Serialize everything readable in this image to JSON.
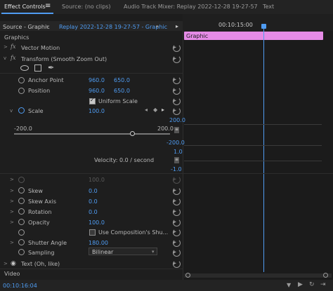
{
  "tabs": {
    "effect_controls": "Effect Controls",
    "menu_icon": "≡",
    "source": "Source: (no clips)",
    "audio_mixer": "Audio Track Mixer: Replay 2022-12-28 19-27-57",
    "text": "Text"
  },
  "header": {
    "source_selector": "Source - Graphic",
    "sequence_selector": "Replay 2022-12-28 19-27-57 - Graphic",
    "ruler_time": "00:10:15:00"
  },
  "timeline": {
    "clip_label": "Graphic",
    "clip_color": "#e58be6"
  },
  "effects": {
    "graphics_heading": "Graphics",
    "vector_motion": "Vector Motion",
    "transform": "Transform (Smooth Zoom Out)",
    "anchor_point": {
      "label": "Anchor Point",
      "x": "960.0",
      "y": "650.0"
    },
    "position": {
      "label": "Position",
      "x": "960.0",
      "y": "650.0"
    },
    "uniform_scale": "Uniform Scale",
    "scale": {
      "label": "Scale",
      "value": "100.0"
    },
    "scale_graph": {
      "slider_min": "-200.0",
      "slider_max": "200.0",
      "top_max": "200.0",
      "top_min": "-200.0",
      "velocity_max": "1.0",
      "velocity_min": "-1.0",
      "velocity_text": "Velocity: 0.0 / second"
    },
    "disabled_value": "100.0",
    "skew": {
      "label": "Skew",
      "value": "0.0"
    },
    "skew_axis": {
      "label": "Skew Axis",
      "value": "0.0"
    },
    "rotation": {
      "label": "Rotation",
      "value": "0.0"
    },
    "opacity": {
      "label": "Opacity",
      "value": "100.0"
    },
    "use_comp_shutter": "Use Composition's Shu...",
    "shutter_angle": {
      "label": "Shutter Angle",
      "value": "180.00"
    },
    "sampling": {
      "label": "Sampling",
      "value": "Bilinear"
    },
    "text_layer": "Text (Oh, like)",
    "video_heading": "Video"
  },
  "footer": {
    "timecode": "00:10:16:04"
  }
}
